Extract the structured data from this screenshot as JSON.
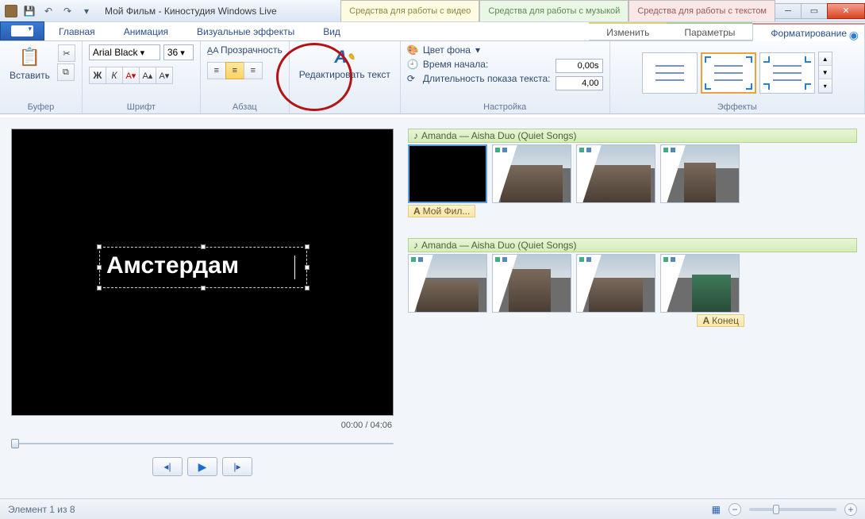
{
  "title": "Мой Фильм - Киностудия Windows Live",
  "contextTabs": {
    "video": "Средства для работы с видео",
    "music": "Средства для работы с музыкой",
    "text": "Средства для работы с текстом"
  },
  "tabs": {
    "home": "Главная",
    "anim": "Анимация",
    "vfx": "Визуальные эффекты",
    "view": "Вид",
    "edit": "Изменить",
    "params": "Параметры",
    "format": "Форматирование"
  },
  "ribbon": {
    "paste": "Вставить",
    "bufferGroup": "Буфер",
    "font": {
      "name": "Arial Black",
      "size": "36"
    },
    "fontGroup": "Шрифт",
    "transparency": "Прозрачность",
    "paraGroup": "Абзац",
    "editText": "Редактировать текст",
    "bgColor": "Цвет фона",
    "startTime": {
      "label": "Время начала:",
      "value": "0,00s"
    },
    "duration": {
      "label": "Длительность показа текста:",
      "value": "4,00"
    },
    "settingsGroup": "Настройка",
    "effectsGroup": "Эффекты"
  },
  "preview": {
    "overlayText": "Амстердам",
    "timecode": "00:00 / 04:06"
  },
  "timeline": {
    "track1": "Amanda — Aisha Duo (Quiet Songs)",
    "textClip1": "Мой Фил...",
    "track2": "Amanda — Aisha Duo (Quiet Songs)",
    "endClip": "Конец"
  },
  "status": {
    "left": "Элемент 1 из 8"
  }
}
